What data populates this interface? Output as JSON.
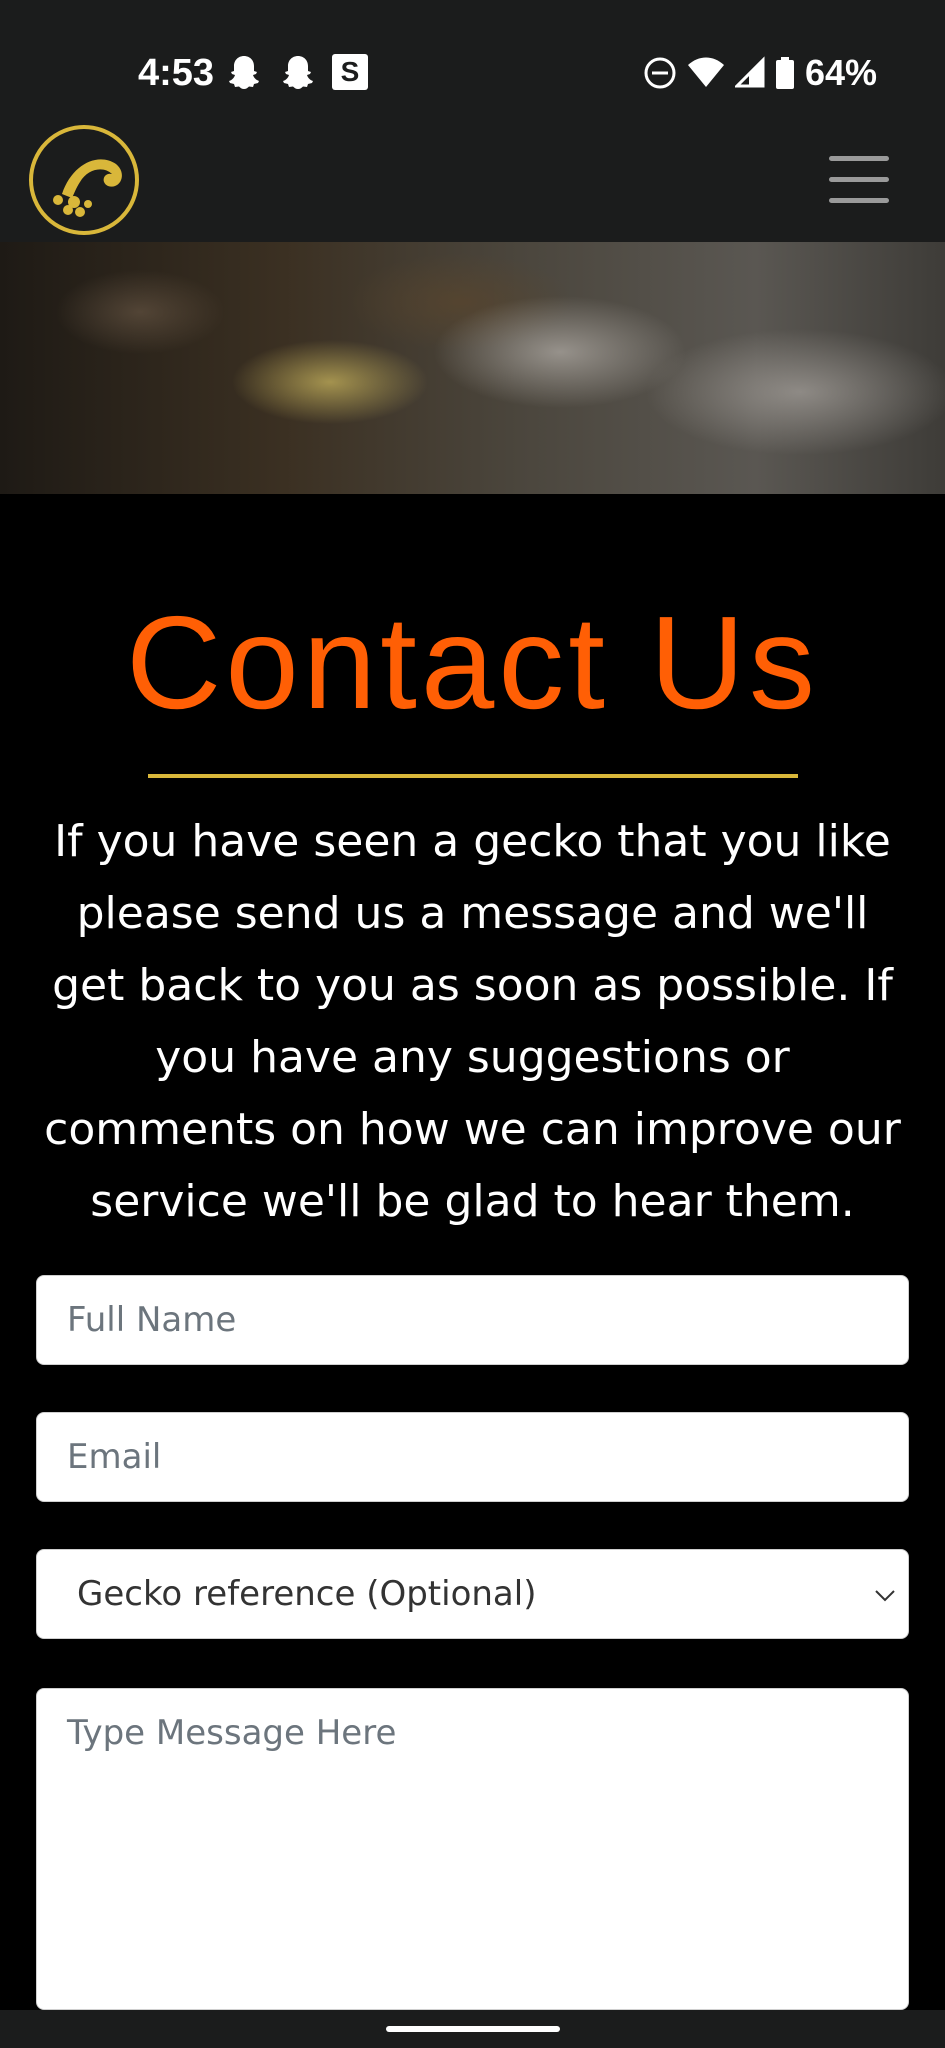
{
  "status_bar": {
    "time": "4:53",
    "left_icons": [
      "snapchat-icon",
      "snapchat-icon",
      "s-app-icon"
    ],
    "s_app_letter": "S",
    "right_icons": [
      "do-not-disturb-icon",
      "wifi-icon",
      "signal-icon",
      "battery-icon"
    ],
    "battery_percent": "64%"
  },
  "header": {
    "logo": "gecko-logo-icon",
    "menu": "hamburger-menu-icon"
  },
  "colors": {
    "page_bg": "#000000",
    "header_bg": "#1b1c1c",
    "title": "#ff5f05",
    "rule": "#d9b73a",
    "logo": "#d9b73a"
  },
  "page": {
    "title": "Contact Us",
    "intro": "If you have seen a gecko that you like please send us a message and we'll get back to you as soon as possible. If you have any suggestions or comments on how we can improve our service we'll be glad to hear them."
  },
  "form": {
    "full_name_placeholder": "Full Name",
    "email_placeholder": "Email",
    "gecko_reference_selected": "Gecko reference (Optional)",
    "message_placeholder": "Type Message Here"
  }
}
